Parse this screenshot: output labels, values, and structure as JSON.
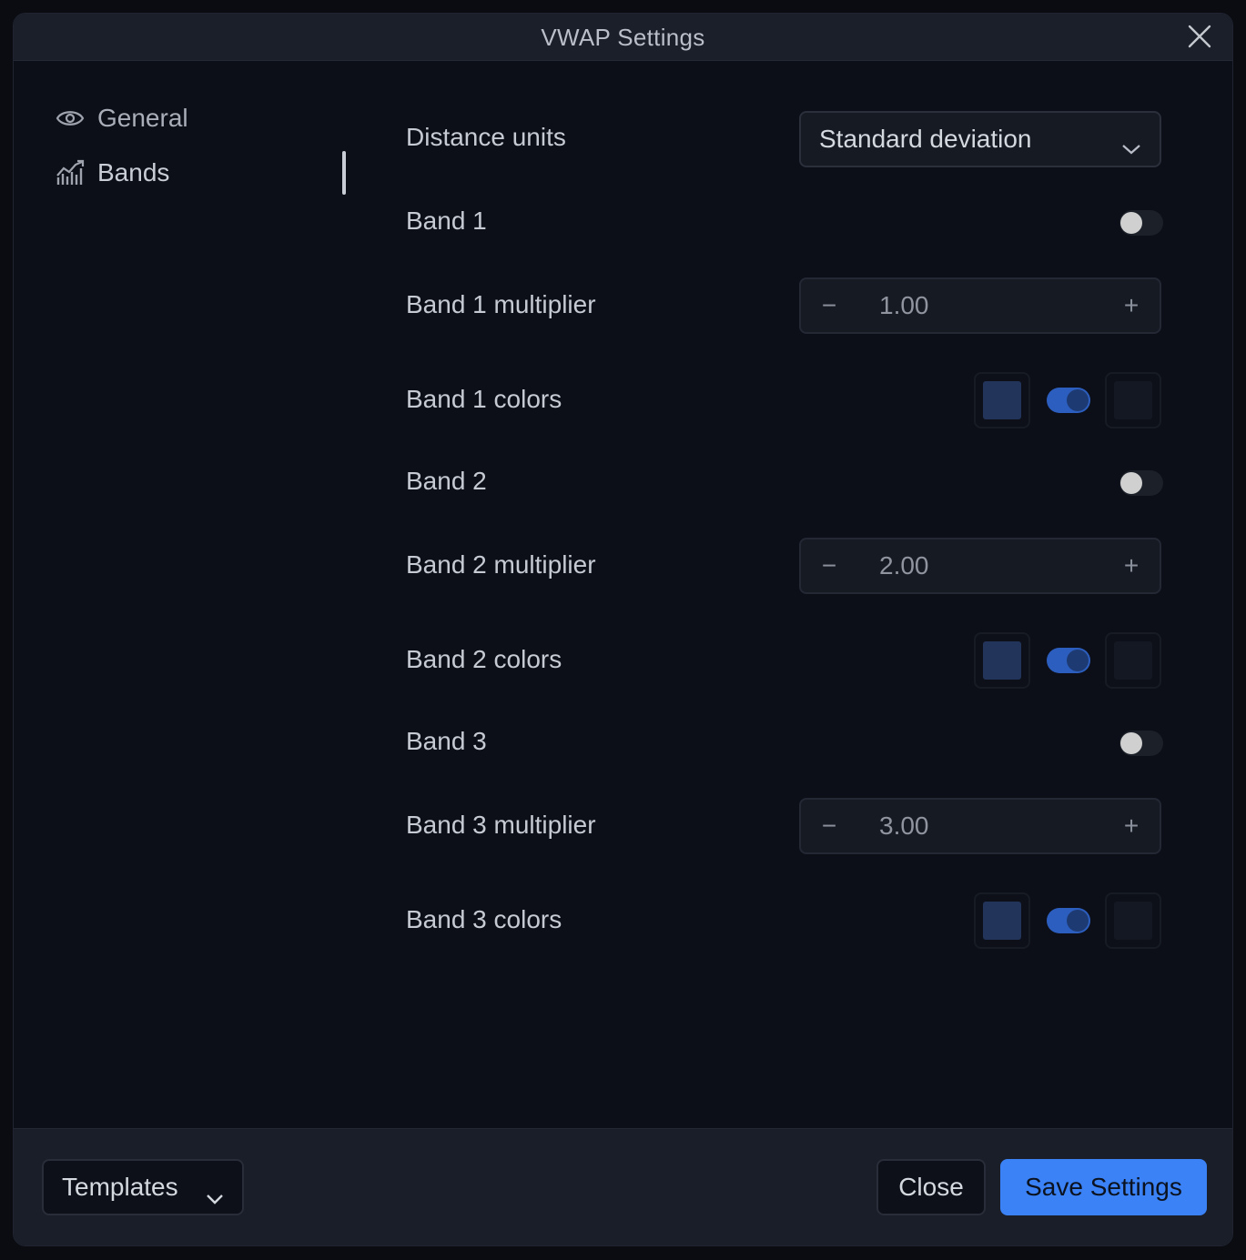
{
  "dialog": {
    "title": "VWAP Settings",
    "close_icon": "close-icon"
  },
  "sidebar": {
    "items": [
      {
        "label": "General",
        "icon": "eye-icon",
        "active": false
      },
      {
        "label": "Bands",
        "icon": "chart-bars-icon",
        "active": true
      }
    ]
  },
  "settings": {
    "distance_units": {
      "label": "Distance units",
      "value": "Standard deviation"
    },
    "bands": [
      {
        "label": "Band 1",
        "enabled": false,
        "multiplier_label": "Band 1 multiplier",
        "multiplier": "1.00",
        "colors_label": "Band 1 colors",
        "color_a": "#223459",
        "color_b": "#141822",
        "color_toggle_on": true
      },
      {
        "label": "Band 2",
        "enabled": false,
        "multiplier_label": "Band 2 multiplier",
        "multiplier": "2.00",
        "colors_label": "Band 2 colors",
        "color_a": "#223459",
        "color_b": "#141822",
        "color_toggle_on": true
      },
      {
        "label": "Band 3",
        "enabled": false,
        "multiplier_label": "Band 3 multiplier",
        "multiplier": "3.00",
        "colors_label": "Band 3 colors",
        "color_a": "#223459",
        "color_b": "#141822",
        "color_toggle_on": true
      }
    ]
  },
  "footer": {
    "templates_label": "Templates",
    "close_label": "Close",
    "save_label": "Save Settings"
  },
  "colors": {
    "accent": "#3b82f6",
    "toggle_on": "#2c5ebf"
  }
}
